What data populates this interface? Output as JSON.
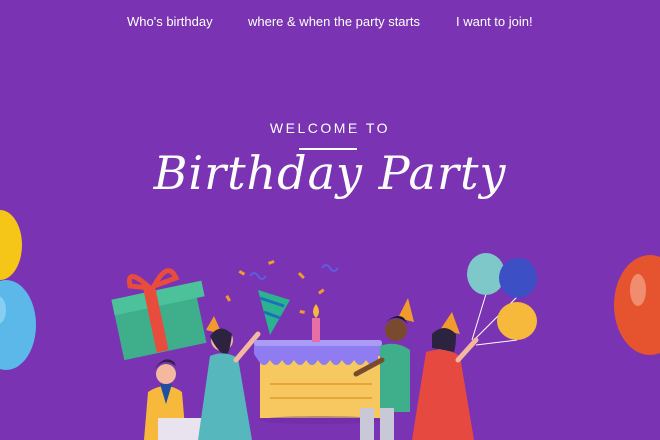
{
  "nav": {
    "items": [
      {
        "label": "Who's birthday"
      },
      {
        "label": "where & when the party starts"
      },
      {
        "label": "I want to join!"
      }
    ]
  },
  "hero": {
    "eyebrow": "WELCOME TO",
    "title": "Birthday Party"
  },
  "colors": {
    "background": "#7a33b2",
    "text": "#ffffff",
    "cake": "#f6c85f",
    "cake_top": "#8e7cf0",
    "gift": "#3fae8b",
    "ribbon": "#e74c3c"
  },
  "icons": [
    "balloon-icon",
    "gift-icon",
    "birthday-cake-icon",
    "party-hat-icon",
    "candle-icon"
  ]
}
